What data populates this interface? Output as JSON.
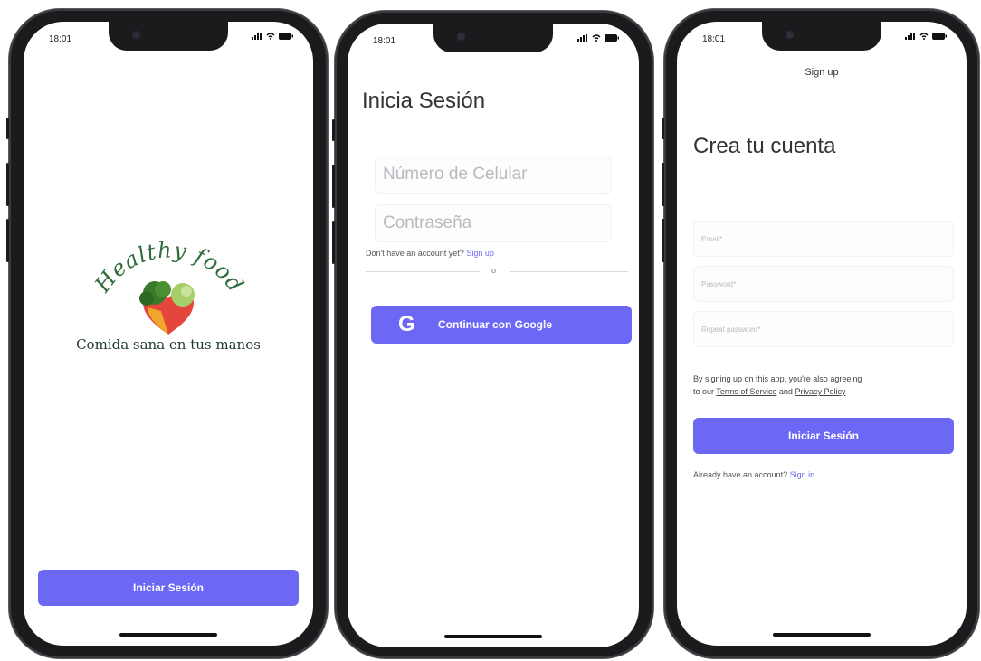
{
  "status_bar": {
    "time": "18:01"
  },
  "splash": {
    "logo_title": "Healthy food",
    "tagline": "Comida sana en tus manos",
    "button_label": "Iniciar Sesión"
  },
  "login": {
    "heading": "Inicia Sesión",
    "phone_placeholder": "Número de Celular",
    "password_placeholder": "Contraseña",
    "no_account_text": "Don't have an account yet?",
    "sign_up_link": "Sign up",
    "divider_text": "o",
    "google_button": "Continuar con Google"
  },
  "signup": {
    "nav_title": "Sign up",
    "heading": "Crea tu cuenta",
    "email_placeholder": "Email*",
    "password_placeholder": "Password*",
    "repeat_password_placeholder": "Repeat password*",
    "terms_line1": "By signing up on this app, you're also agreeing",
    "terms_prefix": "to our",
    "terms_of_service": "Terms of Service",
    "terms_and": "and",
    "privacy_policy": "Privacy Policy",
    "button_label": "Iniciar Sesión",
    "have_account_text": "Already have an account?",
    "sign_in_link": "Sign in"
  },
  "colors": {
    "accent": "#6c67f5",
    "frame": "#1b1b1d",
    "logo_green": "#2e6b3a"
  },
  "icons": [
    "signal-icon",
    "wifi-icon",
    "battery-icon",
    "google-g-icon",
    "heart-vegetables-icon"
  ]
}
